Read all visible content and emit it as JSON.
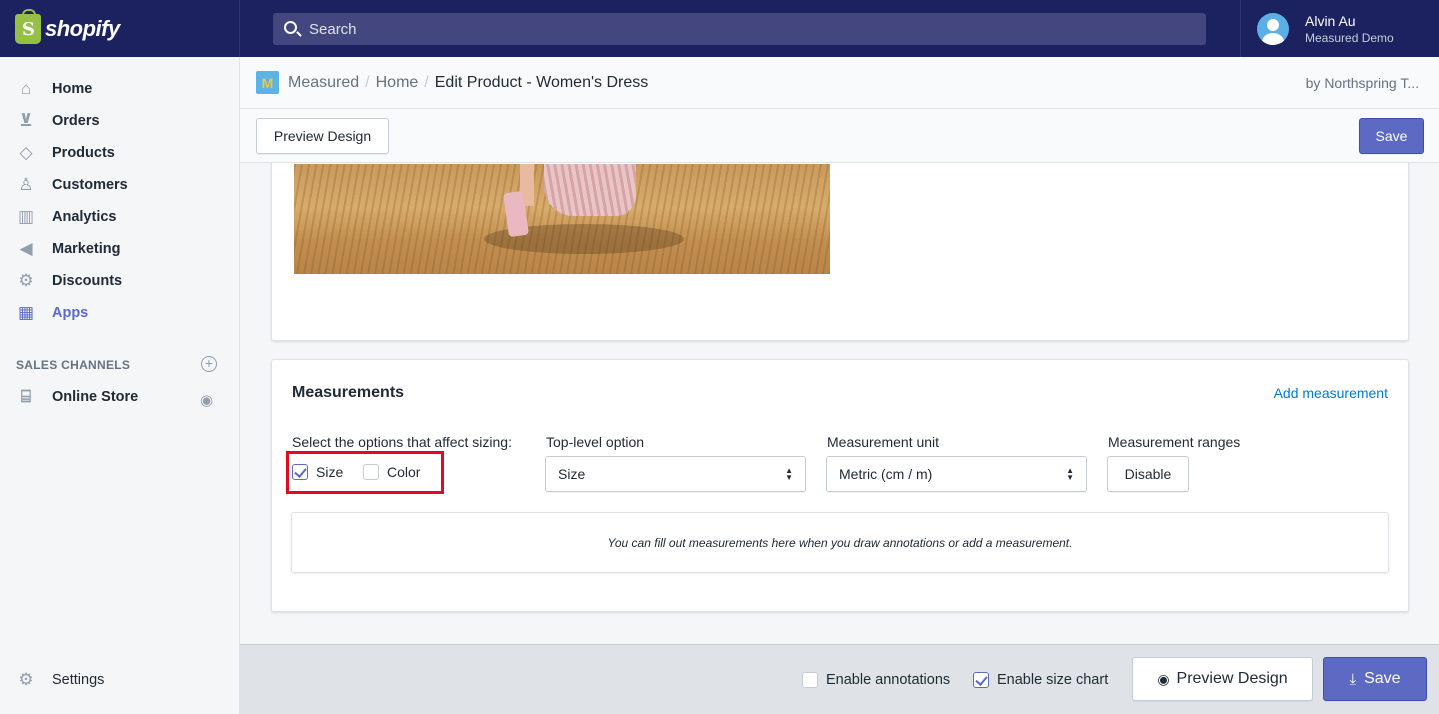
{
  "topbar": {
    "brand": "shopify",
    "search_placeholder": "Search",
    "user_name": "Alvin Au",
    "user_shop": "Measured Demo"
  },
  "sidebar": {
    "items": [
      {
        "label": "Home",
        "icon": "home-icon"
      },
      {
        "label": "Orders",
        "icon": "orders-icon"
      },
      {
        "label": "Products",
        "icon": "tag-icon"
      },
      {
        "label": "Customers",
        "icon": "person-icon"
      },
      {
        "label": "Analytics",
        "icon": "bar-chart-icon"
      },
      {
        "label": "Marketing",
        "icon": "megaphone-icon"
      },
      {
        "label": "Discounts",
        "icon": "discount-icon"
      },
      {
        "label": "Apps",
        "icon": "apps-icon",
        "active": true
      }
    ],
    "sales_channels_heading": "SALES CHANNELS",
    "online_store": "Online Store",
    "settings": "Settings"
  },
  "breadcrumb": {
    "app": "Measured",
    "home": "Home",
    "current": "Edit Product - Women's Dress",
    "byline": "by Northspring T..."
  },
  "actionbar": {
    "preview_label": "Preview Design",
    "save_label": "Save"
  },
  "measurements": {
    "title": "Measurements",
    "add_link": "Add measurement",
    "sizing_label": "Select the options that affect sizing:",
    "options": [
      {
        "label": "Size",
        "checked": true
      },
      {
        "label": "Color",
        "checked": false
      }
    ],
    "top_level_label": "Top-level option",
    "top_level_value": "Size",
    "unit_label": "Measurement unit",
    "unit_value": "Metric (cm / m)",
    "ranges_label": "Measurement ranges",
    "ranges_button": "Disable",
    "empty_text": "You can fill out measurements here when you draw annotations or add a measurement."
  },
  "footer": {
    "enable_annotations": "Enable annotations",
    "enable_annotations_checked": false,
    "enable_size_chart": "Enable size chart",
    "enable_size_chart_checked": true,
    "preview_label": "Preview Design",
    "save_label": "Save"
  },
  "colors": {
    "topbar": "#1c2260",
    "primary": "#5c6ac4",
    "link": "#007ace",
    "highlight": "#e00b1f"
  }
}
